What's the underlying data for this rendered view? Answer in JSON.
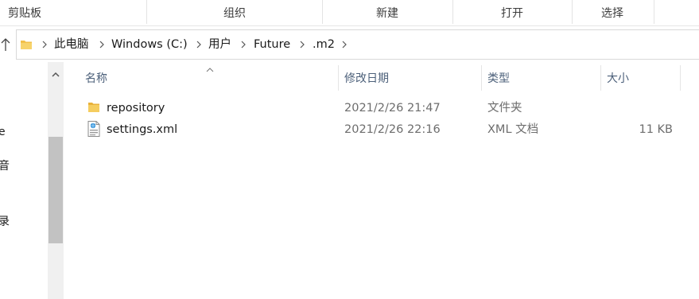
{
  "ribbon": {
    "groups": [
      {
        "label": "剪贴板"
      },
      {
        "label": "组织"
      },
      {
        "label": "新建"
      },
      {
        "label": "打开"
      },
      {
        "label": "选择"
      }
    ]
  },
  "address_bar": {
    "breadcrumbs": [
      "此电脑",
      "Windows (C:)",
      "用户",
      "Future",
      ".m2"
    ]
  },
  "nav_pane": {
    "partial_labels": [
      "e",
      "音",
      "录"
    ]
  },
  "columns": {
    "name": "名称",
    "modified": "修改日期",
    "type": "类型",
    "size": "大小"
  },
  "files": [
    {
      "name": "repository",
      "modified": "2021/2/26 21:47",
      "type": "文件夹",
      "size": "",
      "icon": "folder-icon"
    },
    {
      "name": "settings.xml",
      "modified": "2021/2/26 22:16",
      "type": "XML 文档",
      "size": "11 KB",
      "icon": "xml-file-icon"
    }
  ],
  "colors": {
    "folder": "#f2c04a",
    "header_text": "#4c607a",
    "meta_text": "#6d6d6d",
    "scroll_thumb": "#c2c2c2"
  }
}
